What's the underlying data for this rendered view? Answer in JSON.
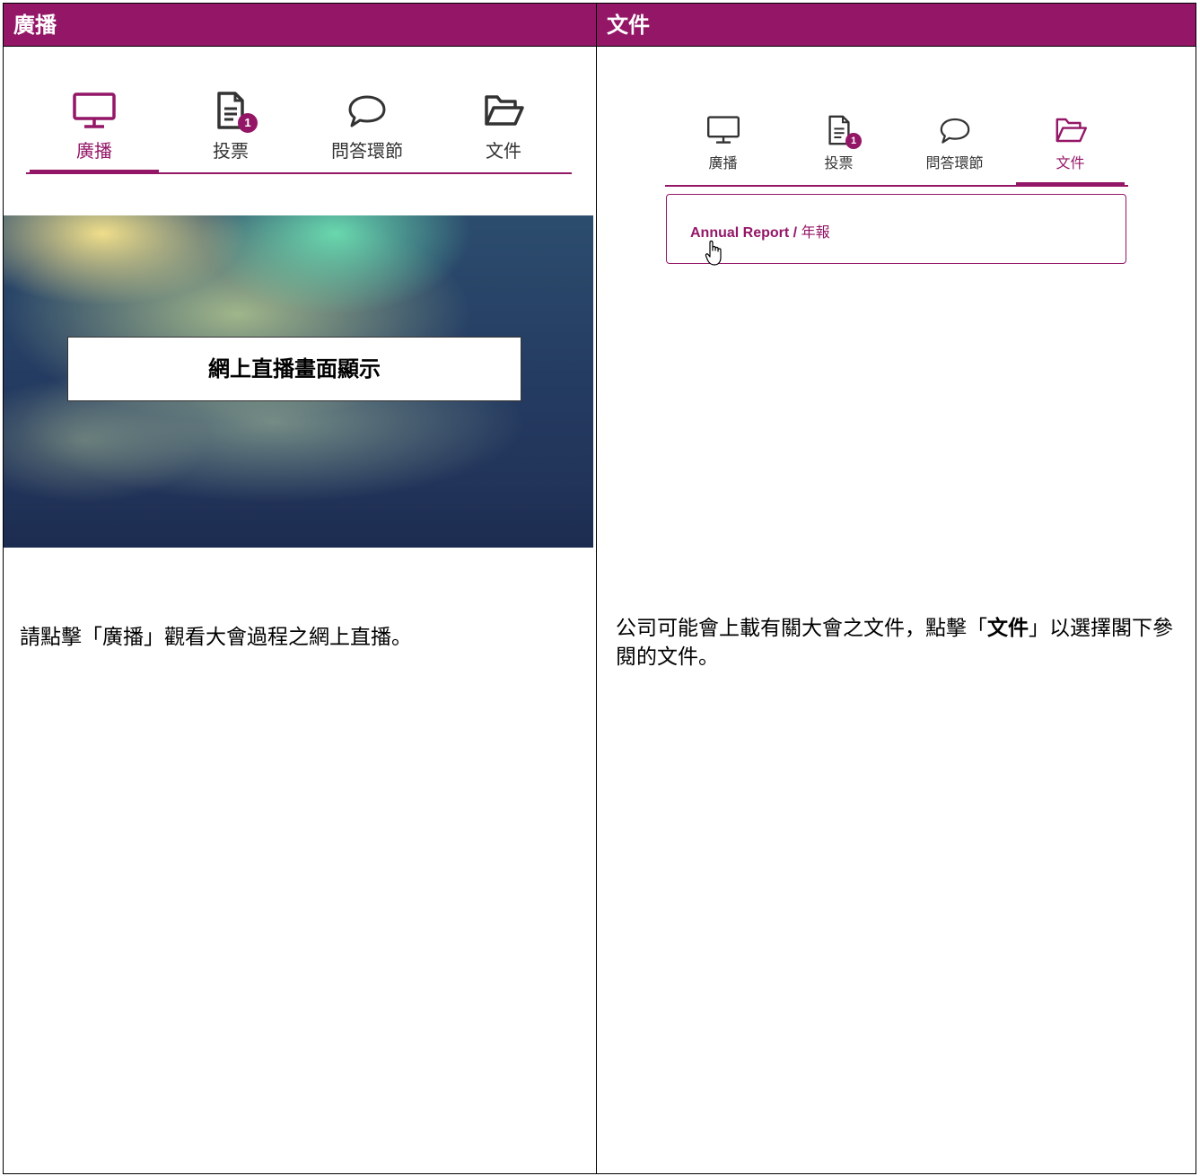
{
  "left": {
    "header": "廣播",
    "tabs": [
      {
        "label": "廣播",
        "icon": "monitor-icon",
        "active": true
      },
      {
        "label": "投票",
        "icon": "document-icon",
        "badge": "1"
      },
      {
        "label": "問答環節",
        "icon": "chat-bubble-icon"
      },
      {
        "label": "文件",
        "icon": "folder-icon"
      }
    ],
    "video_label": "網上直播畫面顯示",
    "description": "請點擊「廣播」觀看大會過程之網上直播。"
  },
  "right": {
    "header": "文件",
    "tabs": [
      {
        "label": "廣播",
        "icon": "monitor-icon"
      },
      {
        "label": "投票",
        "icon": "document-icon",
        "badge": "1"
      },
      {
        "label": "問答環節",
        "icon": "chat-bubble-icon"
      },
      {
        "label": "文件",
        "icon": "folder-icon",
        "active": true
      }
    ],
    "document_en": "Annual Report",
    "document_sep": " / ",
    "document_zh": "年報",
    "description_pre": "公司可能會上載有關大會之文件，點擊「",
    "description_bold": "文件",
    "description_post": "」以選擇閣下參閱的文件。"
  },
  "colors": {
    "brand": "#941767"
  }
}
